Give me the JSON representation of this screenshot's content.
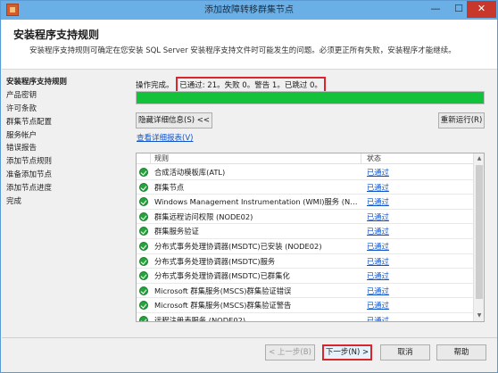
{
  "window": {
    "title": "添加故障转移群集节点",
    "minimize_glyph": "—",
    "maximize_glyph": "☐",
    "close_glyph": "✕"
  },
  "header": {
    "title": "安装程序支持规则",
    "description": "安装程序支持规则可确定在您安装 SQL Server 安装程序支持文件时可能发生的问题。必须更正所有失败，安装程序才能继续。"
  },
  "nav": {
    "items": [
      {
        "label": "安装程序支持规则",
        "active": true
      },
      {
        "label": "产品密钥",
        "active": false
      },
      {
        "label": "许可条款",
        "active": false
      },
      {
        "label": "群集节点配置",
        "active": false
      },
      {
        "label": "服务帐户",
        "active": false
      },
      {
        "label": "错误报告",
        "active": false
      },
      {
        "label": "添加节点规则",
        "active": false
      },
      {
        "label": "准备添加节点",
        "active": false
      },
      {
        "label": "添加节点进度",
        "active": false
      },
      {
        "label": "完成",
        "active": false
      }
    ]
  },
  "main": {
    "operation_label": "操作完成。",
    "summary": "已通过: 21。失败 0。警告 1。已跳过 0。",
    "progress": 1.0,
    "hide_details_label": "隐藏详细信息(S) <<",
    "rerun_label": "重新运行(R)",
    "view_report_label": "查看详细报表(V)",
    "grid": {
      "col_rule": "规则",
      "col_status": "状态",
      "rows": [
        {
          "rule": "合成活动模板库(ATL)",
          "status": "已通过"
        },
        {
          "rule": "群集节点",
          "status": "已通过"
        },
        {
          "rule": "Windows Management Instrumentation (WMI)服务 (NOD...",
          "status": "已通过"
        },
        {
          "rule": "群集远程访问权限 (NODE02)",
          "status": "已通过"
        },
        {
          "rule": "群集服务验证",
          "status": "已通过"
        },
        {
          "rule": "分布式事务处理协调器(MSDTC)已安装 (NODE02)",
          "status": "已通过"
        },
        {
          "rule": "分布式事务处理协调器(MSDTC)服务",
          "status": "已通过"
        },
        {
          "rule": "分布式事务处理协调器(MSDTC)已群集化",
          "status": "已通过"
        },
        {
          "rule": "Microsoft 群集服务(MSCS)群集验证错误",
          "status": "已通过"
        },
        {
          "rule": "Microsoft 群集服务(MSCS)群集验证警告",
          "status": "已通过"
        },
        {
          "rule": "远程注册表服务 (NODE02)",
          "status": "已通过"
        }
      ]
    }
  },
  "footer": {
    "back_label": "< 上一步(B)",
    "next_label": "下一步(N) >",
    "cancel_label": "取消",
    "help_label": "帮助"
  },
  "colors": {
    "titlebar": "#6ab0e6",
    "progress": "#13c23a",
    "highlight_border": "#d9262c",
    "link": "#1155cc",
    "pass_icon": "#24a43a"
  }
}
